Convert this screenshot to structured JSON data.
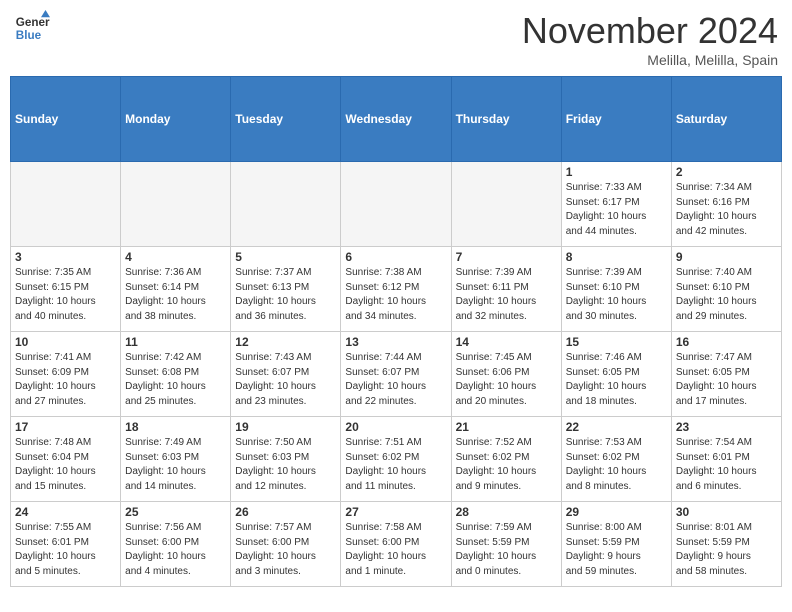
{
  "header": {
    "logo_line1": "General",
    "logo_line2": "Blue",
    "month_title": "November 2024",
    "location": "Melilla, Melilla, Spain"
  },
  "weekdays": [
    "Sunday",
    "Monday",
    "Tuesday",
    "Wednesday",
    "Thursday",
    "Friday",
    "Saturday"
  ],
  "weeks": [
    [
      {
        "day": "",
        "info": ""
      },
      {
        "day": "",
        "info": ""
      },
      {
        "day": "",
        "info": ""
      },
      {
        "day": "",
        "info": ""
      },
      {
        "day": "",
        "info": ""
      },
      {
        "day": "1",
        "info": "Sunrise: 7:33 AM\nSunset: 6:17 PM\nDaylight: 10 hours\nand 44 minutes."
      },
      {
        "day": "2",
        "info": "Sunrise: 7:34 AM\nSunset: 6:16 PM\nDaylight: 10 hours\nand 42 minutes."
      }
    ],
    [
      {
        "day": "3",
        "info": "Sunrise: 7:35 AM\nSunset: 6:15 PM\nDaylight: 10 hours\nand 40 minutes."
      },
      {
        "day": "4",
        "info": "Sunrise: 7:36 AM\nSunset: 6:14 PM\nDaylight: 10 hours\nand 38 minutes."
      },
      {
        "day": "5",
        "info": "Sunrise: 7:37 AM\nSunset: 6:13 PM\nDaylight: 10 hours\nand 36 minutes."
      },
      {
        "day": "6",
        "info": "Sunrise: 7:38 AM\nSunset: 6:12 PM\nDaylight: 10 hours\nand 34 minutes."
      },
      {
        "day": "7",
        "info": "Sunrise: 7:39 AM\nSunset: 6:11 PM\nDaylight: 10 hours\nand 32 minutes."
      },
      {
        "day": "8",
        "info": "Sunrise: 7:39 AM\nSunset: 6:10 PM\nDaylight: 10 hours\nand 30 minutes."
      },
      {
        "day": "9",
        "info": "Sunrise: 7:40 AM\nSunset: 6:10 PM\nDaylight: 10 hours\nand 29 minutes."
      }
    ],
    [
      {
        "day": "10",
        "info": "Sunrise: 7:41 AM\nSunset: 6:09 PM\nDaylight: 10 hours\nand 27 minutes."
      },
      {
        "day": "11",
        "info": "Sunrise: 7:42 AM\nSunset: 6:08 PM\nDaylight: 10 hours\nand 25 minutes."
      },
      {
        "day": "12",
        "info": "Sunrise: 7:43 AM\nSunset: 6:07 PM\nDaylight: 10 hours\nand 23 minutes."
      },
      {
        "day": "13",
        "info": "Sunrise: 7:44 AM\nSunset: 6:07 PM\nDaylight: 10 hours\nand 22 minutes."
      },
      {
        "day": "14",
        "info": "Sunrise: 7:45 AM\nSunset: 6:06 PM\nDaylight: 10 hours\nand 20 minutes."
      },
      {
        "day": "15",
        "info": "Sunrise: 7:46 AM\nSunset: 6:05 PM\nDaylight: 10 hours\nand 18 minutes."
      },
      {
        "day": "16",
        "info": "Sunrise: 7:47 AM\nSunset: 6:05 PM\nDaylight: 10 hours\nand 17 minutes."
      }
    ],
    [
      {
        "day": "17",
        "info": "Sunrise: 7:48 AM\nSunset: 6:04 PM\nDaylight: 10 hours\nand 15 minutes."
      },
      {
        "day": "18",
        "info": "Sunrise: 7:49 AM\nSunset: 6:03 PM\nDaylight: 10 hours\nand 14 minutes."
      },
      {
        "day": "19",
        "info": "Sunrise: 7:50 AM\nSunset: 6:03 PM\nDaylight: 10 hours\nand 12 minutes."
      },
      {
        "day": "20",
        "info": "Sunrise: 7:51 AM\nSunset: 6:02 PM\nDaylight: 10 hours\nand 11 minutes."
      },
      {
        "day": "21",
        "info": "Sunrise: 7:52 AM\nSunset: 6:02 PM\nDaylight: 10 hours\nand 9 minutes."
      },
      {
        "day": "22",
        "info": "Sunrise: 7:53 AM\nSunset: 6:02 PM\nDaylight: 10 hours\nand 8 minutes."
      },
      {
        "day": "23",
        "info": "Sunrise: 7:54 AM\nSunset: 6:01 PM\nDaylight: 10 hours\nand 6 minutes."
      }
    ],
    [
      {
        "day": "24",
        "info": "Sunrise: 7:55 AM\nSunset: 6:01 PM\nDaylight: 10 hours\nand 5 minutes."
      },
      {
        "day": "25",
        "info": "Sunrise: 7:56 AM\nSunset: 6:00 PM\nDaylight: 10 hours\nand 4 minutes."
      },
      {
        "day": "26",
        "info": "Sunrise: 7:57 AM\nSunset: 6:00 PM\nDaylight: 10 hours\nand 3 minutes."
      },
      {
        "day": "27",
        "info": "Sunrise: 7:58 AM\nSunset: 6:00 PM\nDaylight: 10 hours\nand 1 minute."
      },
      {
        "day": "28",
        "info": "Sunrise: 7:59 AM\nSunset: 5:59 PM\nDaylight: 10 hours\nand 0 minutes."
      },
      {
        "day": "29",
        "info": "Sunrise: 8:00 AM\nSunset: 5:59 PM\nDaylight: 9 hours\nand 59 minutes."
      },
      {
        "day": "30",
        "info": "Sunrise: 8:01 AM\nSunset: 5:59 PM\nDaylight: 9 hours\nand 58 minutes."
      }
    ]
  ]
}
